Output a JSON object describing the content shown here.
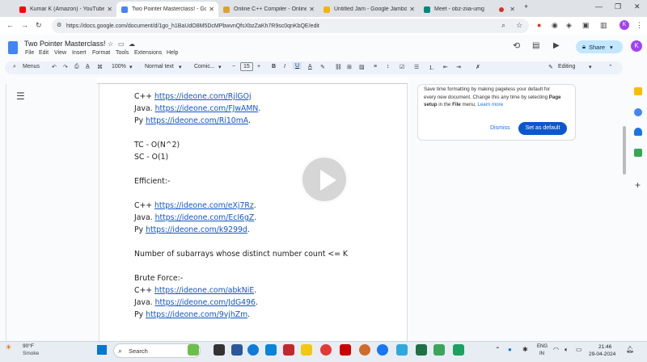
{
  "browser": {
    "tabs": [
      {
        "label": "Kumar K (Amazon) - YouTube",
        "color": "#ff0000"
      },
      {
        "label": "Two Pointer Masterclass! - Go",
        "color": "#4285f4"
      },
      {
        "label": "Online C++ Compiler - Online",
        "color": "#e0a030"
      },
      {
        "label": "Untitled Jam - Google Jamboo",
        "color": "#f4b400"
      },
      {
        "label": "Meet - obz-ziia-umg",
        "color": "#00897b"
      }
    ],
    "url": "https://docs.google.com/document/d/1go_h1BaUdO8M5DcMPbwvnQfsXbzZaKh7R9sc0qnKbQE/edit",
    "profile_letter": "K"
  },
  "docs": {
    "title": "Two Pointer Masterclass!",
    "menus": [
      "File",
      "Edit",
      "View",
      "Insert",
      "Format",
      "Tools",
      "Extensions",
      "Help"
    ],
    "share_label": "Share",
    "toolbar": {
      "menus_label": "Menus",
      "zoom": "100%",
      "style": "Normal text",
      "font": "Comic...",
      "font_size": "15",
      "mode": "Editing"
    }
  },
  "document_lines": [
    {
      "prefix": "C++ ",
      "link": "https://ideone.com/RjlGOj",
      "suffix": ""
    },
    {
      "prefix": "Java. ",
      "link": "https://ideone.com/FJwAMN",
      "suffix": "."
    },
    {
      "prefix": "Py ",
      "link": "https://ideone.com/Ri10mA",
      "suffix": "."
    },
    {
      "text": ""
    },
    {
      "text": "TC - O(N^2)"
    },
    {
      "text": "SC - O(1)"
    },
    {
      "text": ""
    },
    {
      "text": "Efficient:-"
    },
    {
      "text": ""
    },
    {
      "prefix": "C++ ",
      "link": "https://ideone.com/eXj7Rz",
      "suffix": "."
    },
    {
      "prefix": "Java. ",
      "link": "https://ideone.com/EcI6gZ",
      "suffix": "."
    },
    {
      "prefix": "Py ",
      "link": "https://ideone.com/k9299d",
      "suffix": "."
    },
    {
      "text": ""
    },
    {
      "text": "Number of subarrays whose distinct number count <= K"
    },
    {
      "text": ""
    },
    {
      "text": "Brute Force:-"
    },
    {
      "prefix": "C++ ",
      "link": "https://ideone.com/abkNiE",
      "suffix": "."
    },
    {
      "prefix": "Java. ",
      "link": "https://ideone.com/JdG496",
      "suffix": "."
    },
    {
      "prefix": "Py ",
      "link": "https://ideone.com/9vjhZm",
      "suffix": "."
    }
  ],
  "tip": {
    "line1": "Save time formatting by making pageless your default for",
    "line2": "every new document. Change this any time by selecting",
    "page_setup": "Page setup",
    "in_the": " in the ",
    "file_menu": "File",
    "menu_word": " menu. ",
    "learn_more": "Learn more",
    "dismiss": "Dismiss",
    "set_default": "Set as default"
  },
  "taskbar": {
    "weather_temp": "90°F",
    "weather_desc": "Smoke",
    "search_placeholder": "Search",
    "lang_top": "ENG",
    "lang_bottom": "IN",
    "time": "21:46",
    "date": "29-04-2024"
  },
  "colors": {
    "accent": "#0b57d0",
    "link": "#1155cc",
    "share_bg": "#c2e7ff"
  }
}
